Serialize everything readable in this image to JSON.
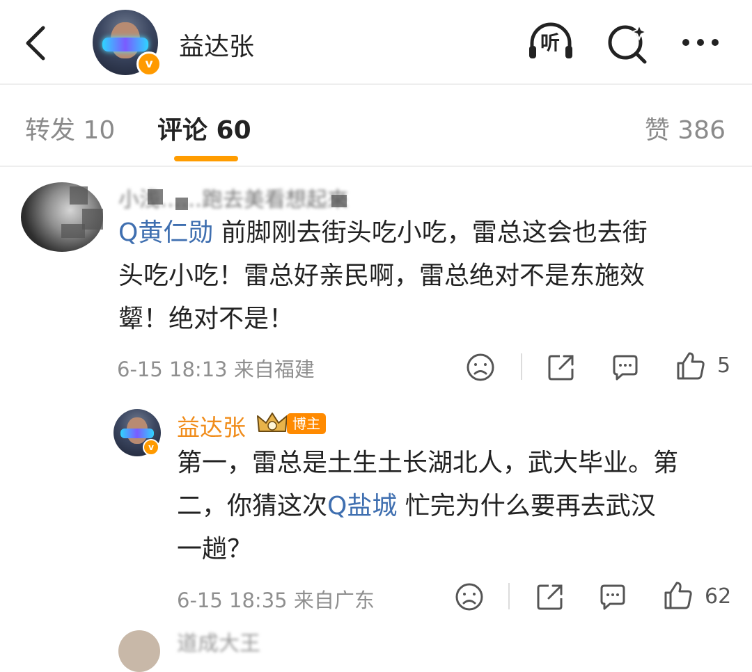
{
  "header": {
    "title": "益达张",
    "badge": "v",
    "listen_label": "听"
  },
  "tabs": {
    "repost": "转发 10",
    "comment": "评论 60",
    "like": "赞 386"
  },
  "comments": [
    {
      "username": "小浅……跑去美看想起來",
      "mention": "Q黄仁勋",
      "text_lines": [
        " 前脚刚去街头吃小吃，雷总这会也去街",
        "头吃小吃！雷总好亲民啊，雷总绝对不是东施效",
        "颦！绝对不是！"
      ],
      "meta": "6-15 18:13 来自福建",
      "likes": "5"
    }
  ],
  "reply": {
    "username": "益达张",
    "badge": "博主",
    "line1": "第一，雷总是土生土长湖北人，武大毕业。第",
    "line2_prefix": "二，你猜这次",
    "line2_mention": "Q盐城",
    "line2_suffix": " 忙完为什么要再去武汉",
    "line3": "一趟？",
    "meta": "6-15 18:35 来自广东",
    "likes": "62"
  },
  "next_comment": {
    "username": "道成大王"
  },
  "icons": {
    "back": "chevron-left-icon",
    "listen": "headphones-listen-icon",
    "search": "search-sparkle-icon",
    "more": "more-dots-icon",
    "dislike": "sad-face-icon",
    "share": "share-icon",
    "reply": "comment-icon",
    "like": "thumbs-up-icon"
  },
  "colors": {
    "accent": "#ff9c00",
    "mention": "#3f6fb0",
    "author_name": "#f08c1a"
  }
}
